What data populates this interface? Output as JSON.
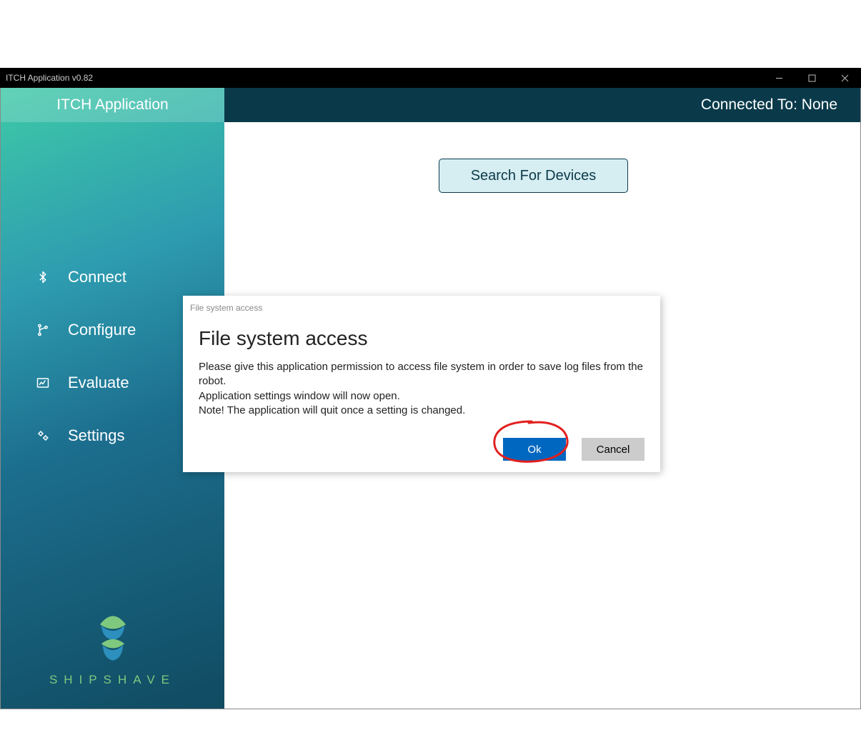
{
  "window": {
    "title": "ITCH Application v0.82"
  },
  "sidebar": {
    "header": "ITCH Application",
    "items": [
      {
        "label": "Connect",
        "icon": "bluetooth-icon"
      },
      {
        "label": "Configure",
        "icon": "branch-icon"
      },
      {
        "label": "Evaluate",
        "icon": "chart-icon"
      },
      {
        "label": "Settings",
        "icon": "gears-icon"
      }
    ],
    "logo_text": "SHIPSHAVE"
  },
  "header": {
    "status_label": "Connected To:",
    "status_value": "None"
  },
  "main": {
    "search_button": "Search For Devices"
  },
  "dialog": {
    "window_title": "File system access",
    "heading": "File system access",
    "body_line1": "Please give this application permission to access file system in order to save log files from the robot.",
    "body_line2": "Application settings window will now open.",
    "body_line3": "Note! The application will quit once a setting is changed.",
    "ok_label": "Ok",
    "cancel_label": "Cancel"
  },
  "annotation": {
    "target": "ok-button",
    "color": "#e1201f"
  }
}
